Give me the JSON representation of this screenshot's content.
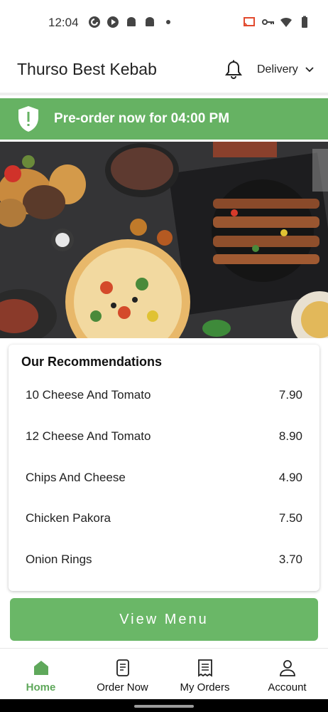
{
  "status_bar": {
    "time": "12:04",
    "left_icons": [
      "pocket-casts-icon",
      "media-icon",
      "android-icon",
      "android-icon",
      "dot-icon"
    ],
    "right_icons": [
      "cast-icon",
      "key-icon",
      "wifi-icon",
      "battery-icon"
    ]
  },
  "header": {
    "title": "Thurso Best Kebab",
    "notification_icon": "bell-icon",
    "delivery_label": "Delivery",
    "delivery_icon": "chevron-down-icon"
  },
  "banner": {
    "text": "Pre-order now for 04:00 PM",
    "icon": "shield-alert-icon",
    "color": "#66b263"
  },
  "recommendations": {
    "title": "Our Recommendations",
    "items": [
      {
        "name": "10 Cheese And Tomato",
        "price": "7.90"
      },
      {
        "name": "12 Cheese And Tomato",
        "price": "8.90"
      },
      {
        "name": "Chips And Cheese",
        "price": "4.90"
      },
      {
        "name": "Chicken Pakora",
        "price": "7.50"
      },
      {
        "name": "Onion Rings",
        "price": "3.70"
      }
    ]
  },
  "view_menu": {
    "label": "View Menu"
  },
  "bottom_nav": {
    "items": [
      {
        "label": "Home",
        "icon": "home-icon",
        "active": true
      },
      {
        "label": "Order Now",
        "icon": "order-now-icon",
        "active": false
      },
      {
        "label": "My Orders",
        "icon": "receipt-icon",
        "active": false
      },
      {
        "label": "Account",
        "icon": "account-icon",
        "active": false
      }
    ]
  },
  "colors": {
    "accent_green": "#66b263",
    "active_nav": "#5fa85b"
  }
}
